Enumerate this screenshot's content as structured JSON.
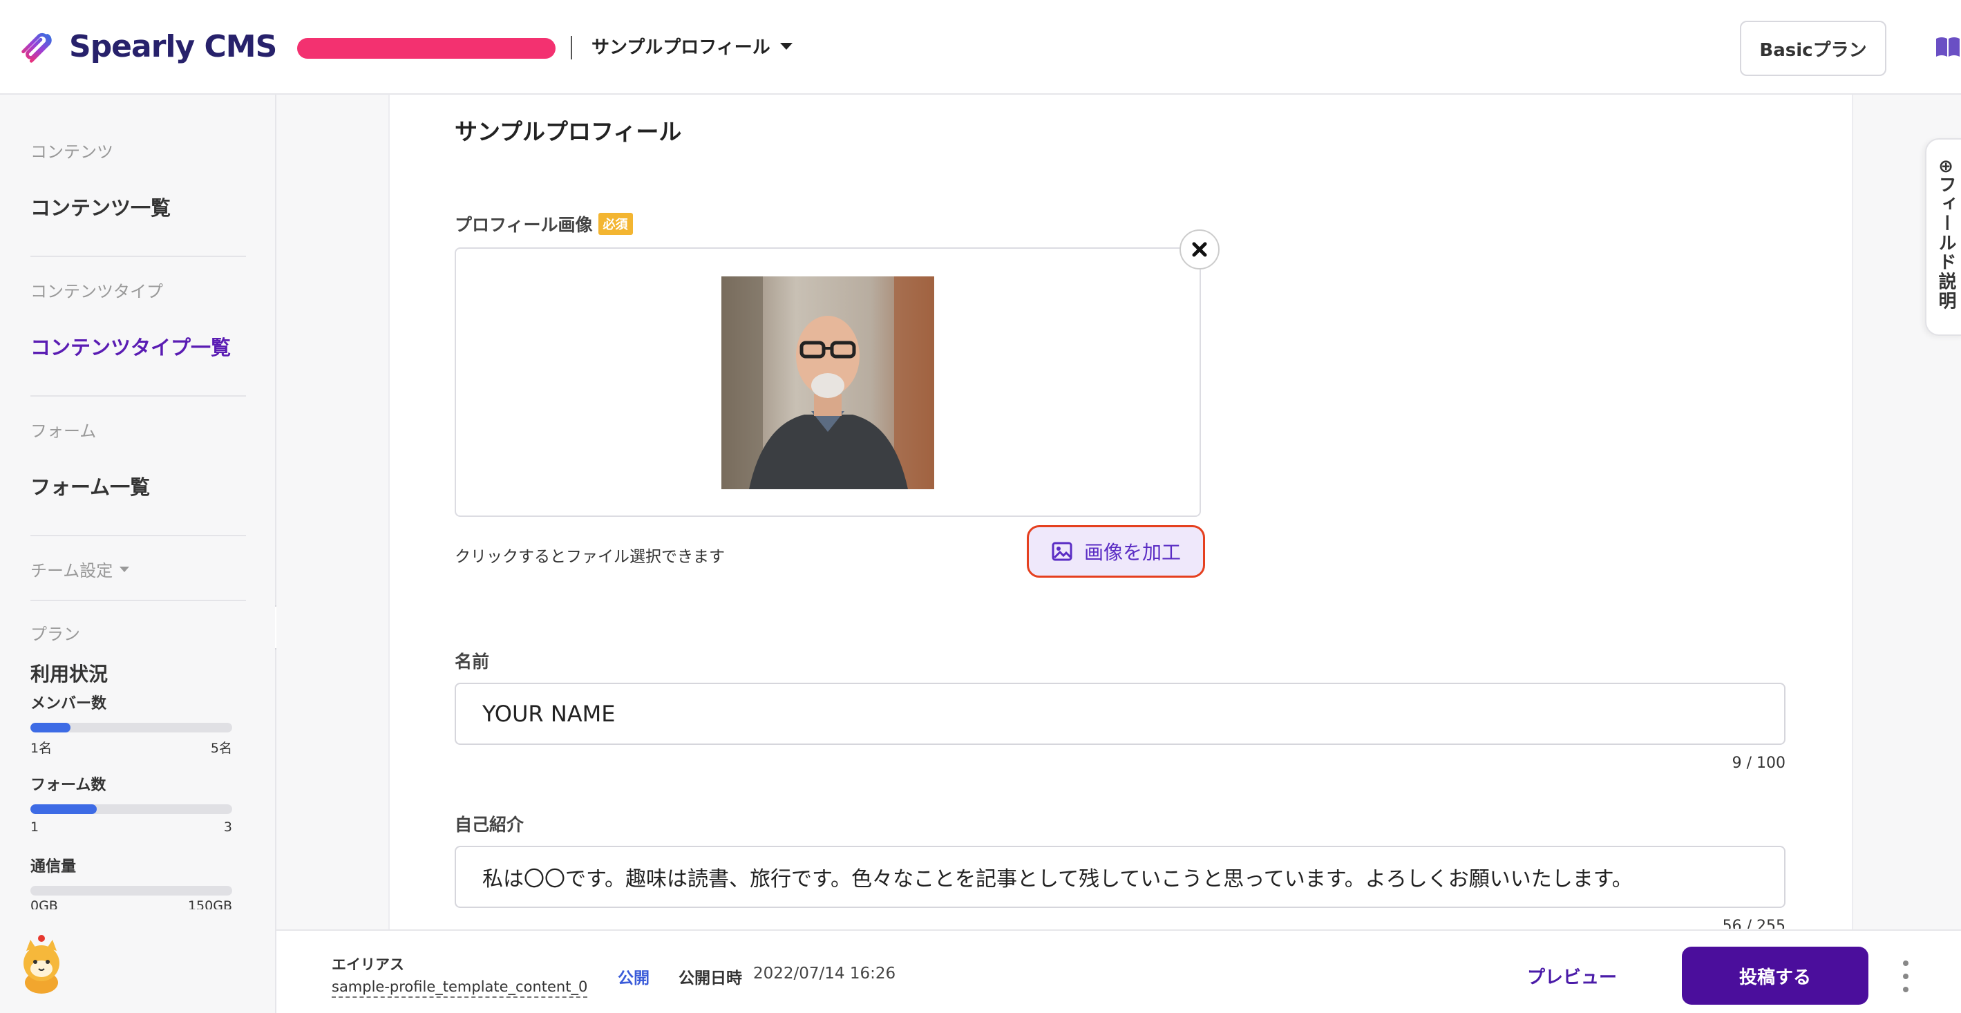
{
  "header": {
    "logo_text": "Spearly CMS",
    "project_name": "サンプルプロフィール",
    "plan_label": "Basicプラン",
    "brand_color": "#27216b",
    "project_bar_color": "#f33170"
  },
  "sidebar": {
    "sections": [
      {
        "heading": "コンテンツ",
        "item": "コンテンツ一覧"
      },
      {
        "heading": "コンテンツタイプ",
        "item": "コンテンツタイプ一覧"
      },
      {
        "heading": "フォーム",
        "item": "フォーム一覧"
      }
    ],
    "team_settings": "チーム設定",
    "plan_heading": "プラン",
    "usage_title": "利用状況",
    "usage": [
      {
        "label": "メンバー数",
        "min": "1名",
        "max": "5名",
        "fraction": 0.2
      },
      {
        "label": "フォーム数",
        "min": "1",
        "max": "3",
        "fraction": 0.33
      },
      {
        "label": "通信量",
        "min": "0GB",
        "max": "150GB",
        "fraction": 0
      }
    ]
  },
  "main": {
    "title": "サンプルプロフィール",
    "image_field": {
      "label": "プロフィール画像",
      "required": "必須",
      "hint": "クリックするとファイル選択できます",
      "edit_button": "画像を加工"
    },
    "name_field": {
      "label": "名前",
      "value": "YOUR NAME",
      "counter": "9 / 100"
    },
    "bio_field": {
      "label": "自己紹介",
      "value": "私は〇〇です。趣味は読書、旅行です。色々なことを記事として残していこうと思っています。よろしくお願いいたします。",
      "counter": "56 / 255"
    },
    "field_desc_tab": "フィールド説明"
  },
  "footer": {
    "alias_label": "エイリアス",
    "alias_value": "sample-profile_template_content_0",
    "status": "公開",
    "pubdate_label": "公開日時",
    "pubdate_value": "2022/07/14 16:26",
    "preview": "プレビュー",
    "submit": "投稿する",
    "accent_color": "#4b0e9c"
  }
}
